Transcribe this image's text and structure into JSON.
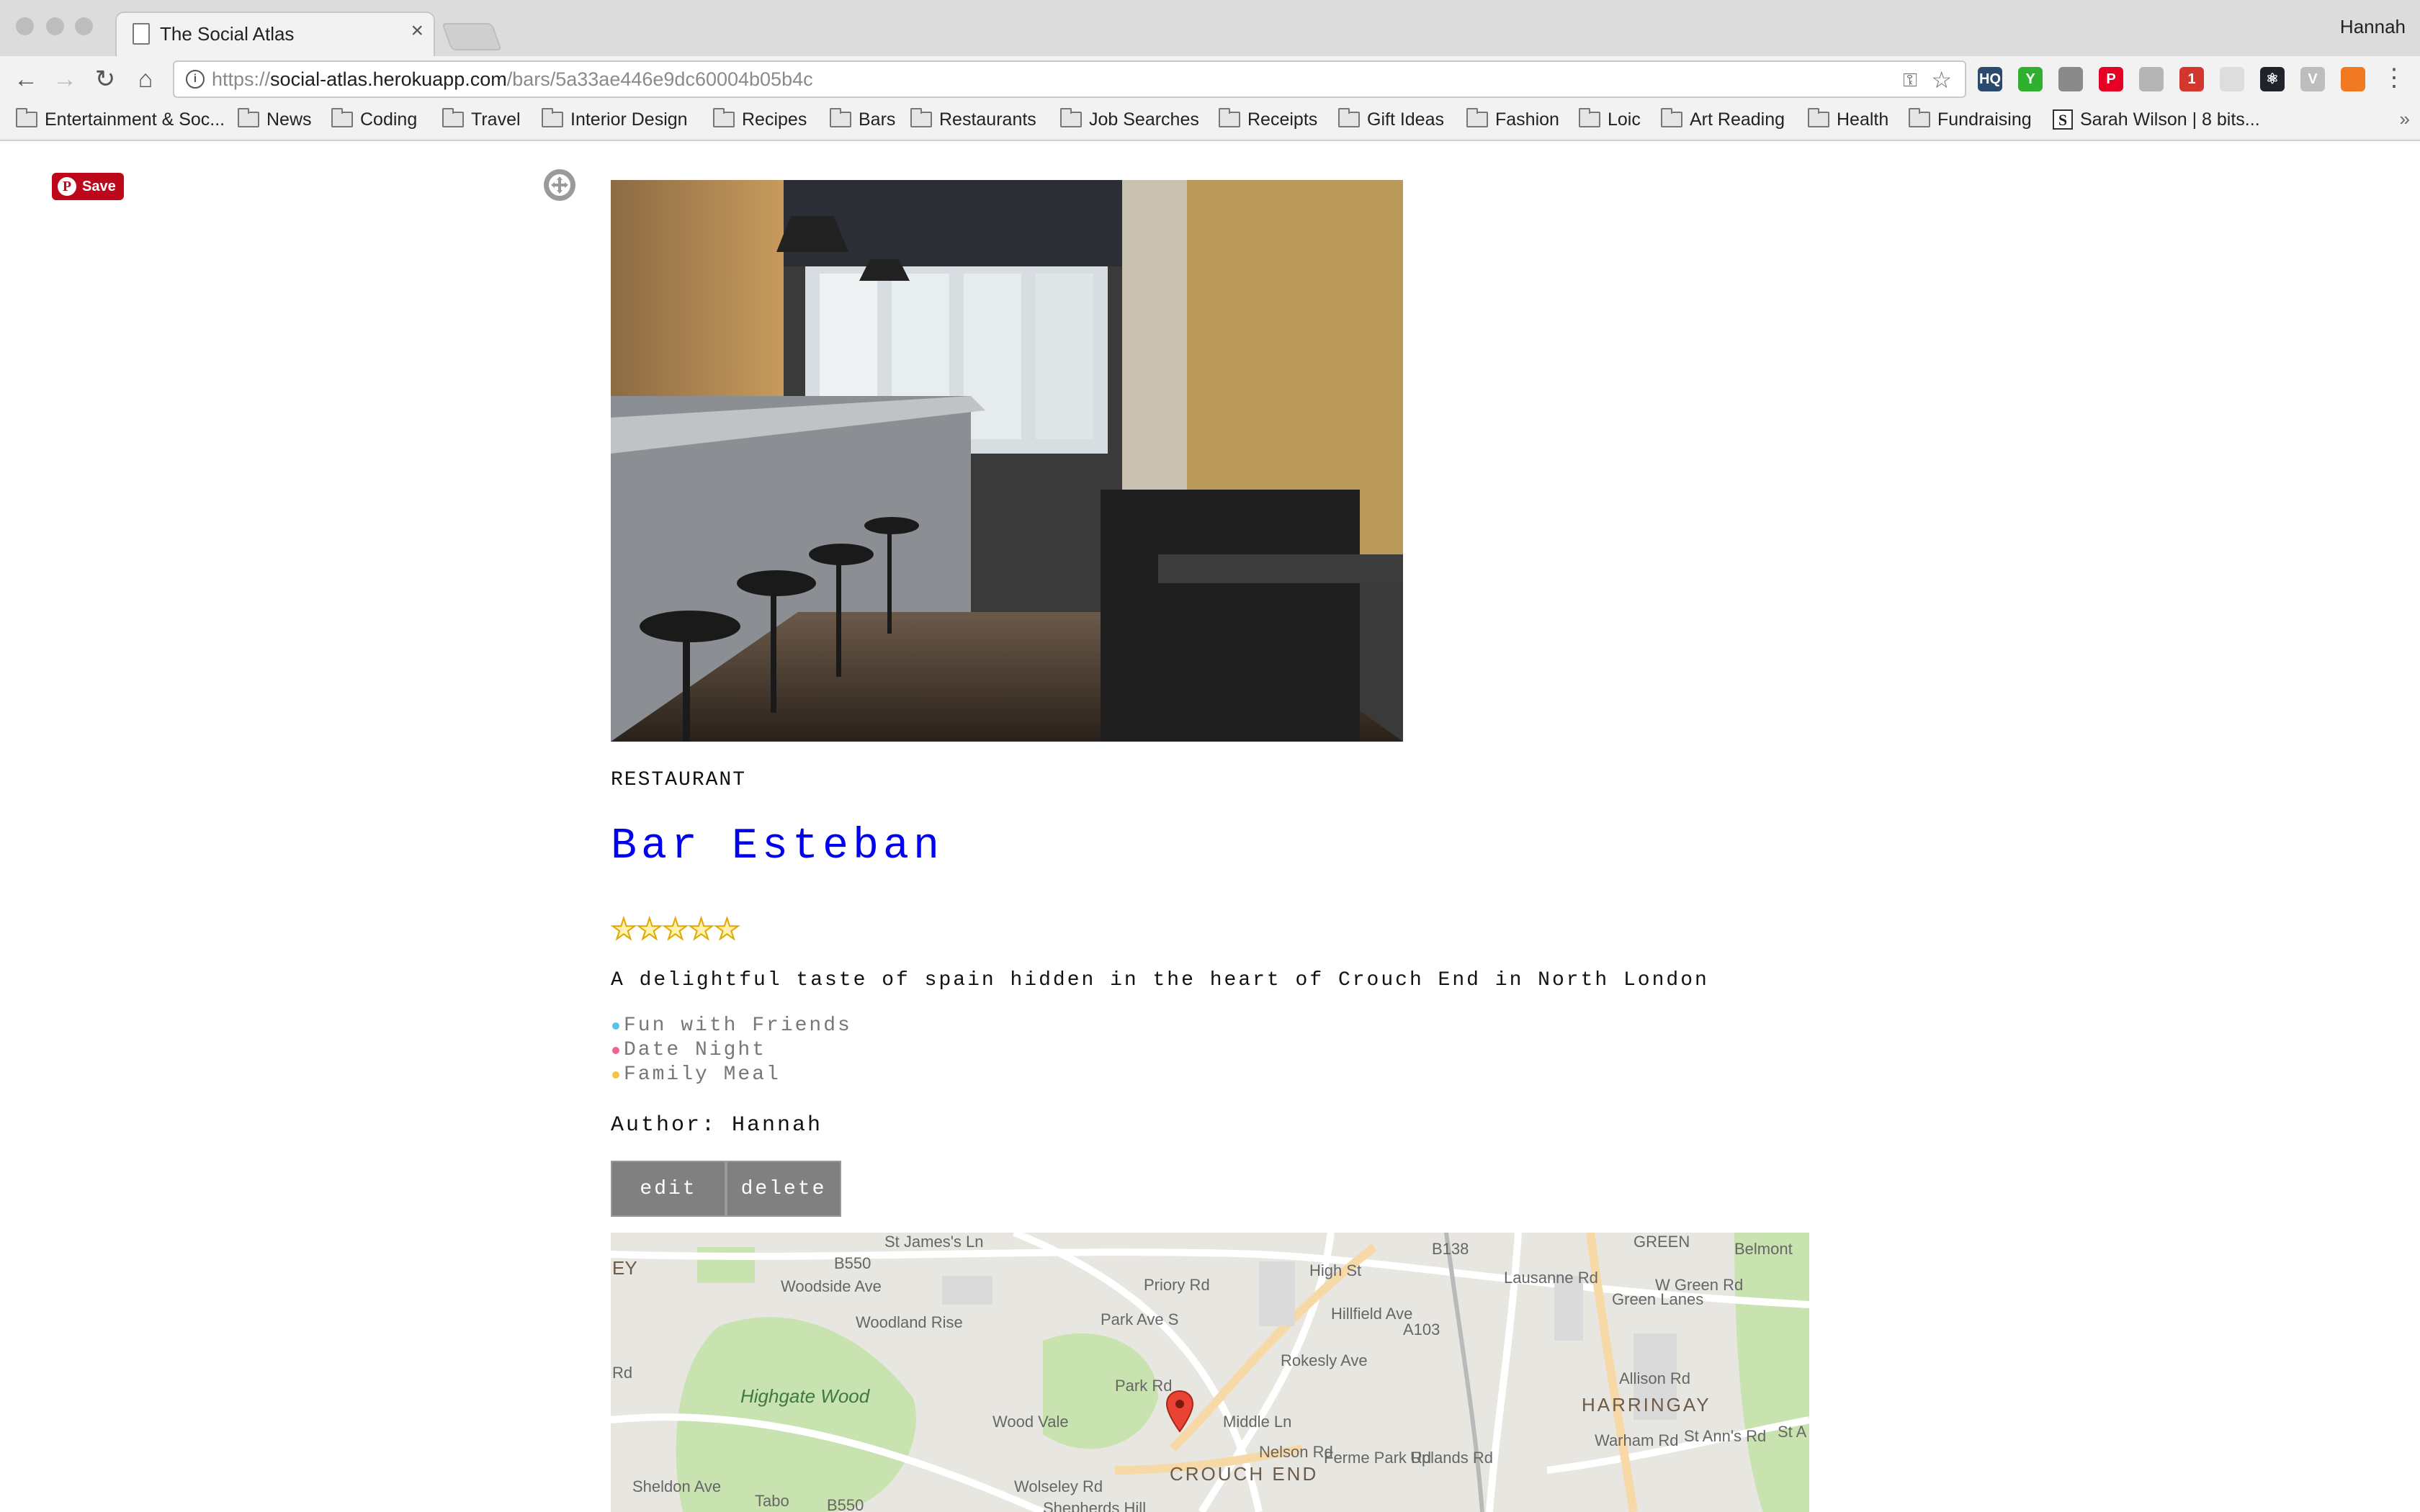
{
  "browser": {
    "tab_title": "The Social Atlas",
    "tab_close": "×",
    "profile_name": "Hannah",
    "url_scheme": "https://",
    "url_host": "social-atlas.herokuapp.com",
    "url_path": "/bars/5a33ae446e9dc60004b05b4c",
    "extensions": [
      {
        "icon": "hq-icon",
        "label": "HQ",
        "color": "#2a4a6e"
      },
      {
        "icon": "y-icon",
        "label": "Y",
        "color": "#2fb12f"
      },
      {
        "icon": "bug-icon",
        "label": "",
        "color": "#8a8a8a"
      },
      {
        "icon": "pinterest-icon",
        "label": "P",
        "color": "#e60023"
      },
      {
        "icon": "puzzle-icon",
        "label": "",
        "color": "#b5b5b5"
      },
      {
        "icon": "badge-icon",
        "label": "1",
        "color": "#d3362d"
      },
      {
        "icon": "circle-icon",
        "label": "",
        "color": "#dddddd"
      },
      {
        "icon": "react-icon",
        "label": "⚛",
        "color": "#20232a"
      },
      {
        "icon": "v-icon",
        "label": "V",
        "color": "#bdbdbd"
      },
      {
        "icon": "fox-icon",
        "label": "",
        "color": "#f07922"
      }
    ]
  },
  "bookmarks": [
    {
      "label": "Entertainment & Soc...",
      "icon": "folder"
    },
    {
      "label": "News",
      "icon": "folder"
    },
    {
      "label": "Coding",
      "icon": "folder"
    },
    {
      "label": "Travel",
      "icon": "folder"
    },
    {
      "label": "Interior Design",
      "icon": "folder"
    },
    {
      "label": "Recipes",
      "icon": "folder"
    },
    {
      "label": "Bars",
      "icon": "folder"
    },
    {
      "label": "Restaurants",
      "icon": "folder"
    },
    {
      "label": "Job Searches",
      "icon": "folder"
    },
    {
      "label": "Receipts",
      "icon": "folder"
    },
    {
      "label": "Gift Ideas",
      "icon": "folder"
    },
    {
      "label": "Fashion",
      "icon": "folder"
    },
    {
      "label": "Loic",
      "icon": "folder"
    },
    {
      "label": "Art Reading",
      "icon": "folder"
    },
    {
      "label": "Health",
      "icon": "folder"
    },
    {
      "label": "Fundraising",
      "icon": "folder"
    },
    {
      "label": "Sarah Wilson | 8 bits...",
      "icon": "site-s"
    }
  ],
  "bookmarks_overflow": "»",
  "page": {
    "pin_save_label": "Save",
    "category": "RESTAURANT",
    "name": "Bar Esteban",
    "rating": 5,
    "stars": "★★★★★",
    "description": "A delightful taste of spain hidden in the heart of Crouch End in North London",
    "tags": [
      {
        "label": "Fun with Friends",
        "color": "#5bc0eb"
      },
      {
        "label": "Date Night",
        "color": "#f06292"
      },
      {
        "label": "Family Meal",
        "color": "#f4c542"
      }
    ],
    "author": "Author: Hannah",
    "edit_label": "edit",
    "delete_label": "delete"
  },
  "map": {
    "labels": [
      "EY",
      "St James's Ln",
      "B550",
      "Woodside Ave",
      "Priory Rd",
      "High St",
      "B138",
      "Lausanne Rd",
      "Green Lanes",
      "W Green Rd",
      "Belmont",
      "Woodland Rise",
      "Park Ave S",
      "Hillfield Ave",
      "A103",
      "Rokesly Ave",
      "Highgate Wood",
      "Wood Vale",
      "Park Rd",
      "Middle Ln",
      "Nelson Rd",
      "Ferme Park Rd",
      "Uplands Rd",
      "Allison Rd",
      "HARRINGAY",
      "Warham Rd",
      "St Ann's Rd",
      "St A",
      "Wolseley Rd",
      "Shepherds Hill",
      "CROUCH END",
      "Sheldon Ave",
      "Tabo",
      "B550",
      "Rd",
      "GREEN"
    ]
  }
}
